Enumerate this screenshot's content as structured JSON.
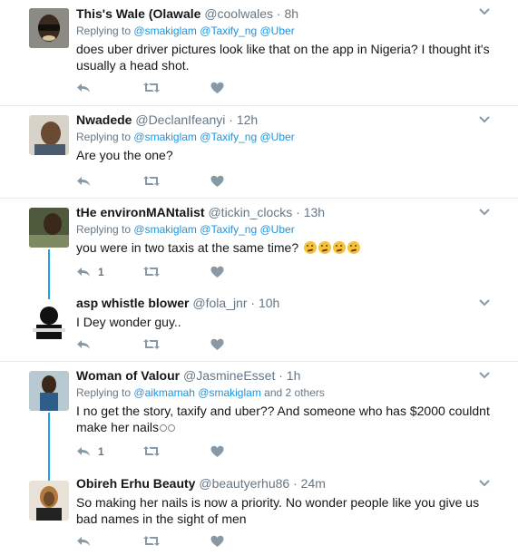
{
  "ui": {
    "replying_prefix": "Replying to",
    "dot": "·"
  },
  "colors": {
    "link": "#1b95e0",
    "muted": "#657786",
    "text": "#14171a",
    "thread_line": "#1da1f2",
    "separator": "#e6ecf0"
  },
  "tweets": [
    {
      "name": "This's Wale (Olawale",
      "handle": "@coolwales",
      "time": "8h",
      "replying_to": [
        "@smakiglam",
        "@Taxify_ng",
        "@Uber"
      ],
      "text": "does uber driver pictures look like that on the app in Nigeria? I thought it's usually a head shot.",
      "reply_count": "",
      "avatar_icon": "avatar-image"
    },
    {
      "name": "Nwadede",
      "handle": "@DeclanIfeanyi",
      "time": "12h",
      "replying_to": [
        "@smakiglam",
        "@Taxify_ng",
        "@Uber"
      ],
      "text": "Are you the one?",
      "reply_count": "",
      "avatar_icon": "avatar-image"
    },
    {
      "name": "tHe environMANtalist",
      "handle": "@tickin_clocks",
      "time": "13h",
      "replying_to": [
        "@smakiglam",
        "@Taxify_ng",
        "@Uber"
      ],
      "text": "you were in two taxis at the same time?",
      "reply_count": "1",
      "avatar_icon": "avatar-image"
    },
    {
      "name": "asp whistle blower",
      "handle": "@fola_jnr",
      "time": "10h",
      "replying_to": [],
      "text": "I Dey wonder guy..",
      "reply_count": "",
      "avatar_icon": "avatar-image"
    },
    {
      "name": "Woman of Valour",
      "handle": "@JasmineEsset",
      "time": "1h",
      "replying_to": [
        "@aikmamah",
        "@smakiglam"
      ],
      "replying_more": "and 2 others",
      "text": "I no get the story, taxify and uber?? And someone who has $2000 couldnt make her nails",
      "reply_count": "1",
      "avatar_icon": "avatar-image"
    },
    {
      "name": "Obireh Erhu Beauty",
      "handle": "@beautyerhu86",
      "time": "24m",
      "replying_to": [],
      "text": "So making her nails is now a priority. No wonder people like you give us bad names in the sight of men",
      "reply_count": "",
      "avatar_icon": "avatar-image"
    }
  ]
}
